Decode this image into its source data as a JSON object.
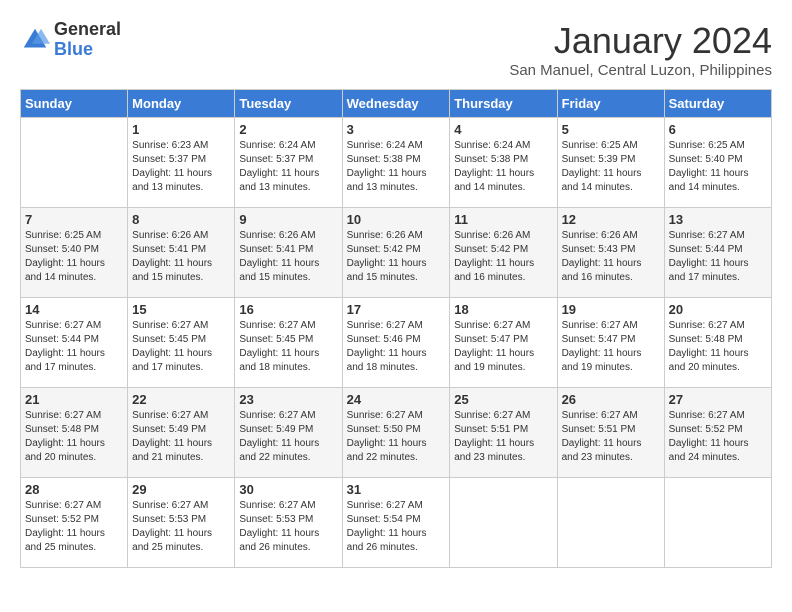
{
  "logo": {
    "general": "General",
    "blue": "Blue"
  },
  "title": "January 2024",
  "subtitle": "San Manuel, Central Luzon, Philippines",
  "columns": [
    "Sunday",
    "Monday",
    "Tuesday",
    "Wednesday",
    "Thursday",
    "Friday",
    "Saturday"
  ],
  "weeks": [
    [
      {
        "day": "",
        "sunrise": "",
        "sunset": "",
        "daylight": ""
      },
      {
        "day": "1",
        "sunrise": "Sunrise: 6:23 AM",
        "sunset": "Sunset: 5:37 PM",
        "daylight": "Daylight: 11 hours and 13 minutes."
      },
      {
        "day": "2",
        "sunrise": "Sunrise: 6:24 AM",
        "sunset": "Sunset: 5:37 PM",
        "daylight": "Daylight: 11 hours and 13 minutes."
      },
      {
        "day": "3",
        "sunrise": "Sunrise: 6:24 AM",
        "sunset": "Sunset: 5:38 PM",
        "daylight": "Daylight: 11 hours and 13 minutes."
      },
      {
        "day": "4",
        "sunrise": "Sunrise: 6:24 AM",
        "sunset": "Sunset: 5:38 PM",
        "daylight": "Daylight: 11 hours and 14 minutes."
      },
      {
        "day": "5",
        "sunrise": "Sunrise: 6:25 AM",
        "sunset": "Sunset: 5:39 PM",
        "daylight": "Daylight: 11 hours and 14 minutes."
      },
      {
        "day": "6",
        "sunrise": "Sunrise: 6:25 AM",
        "sunset": "Sunset: 5:40 PM",
        "daylight": "Daylight: 11 hours and 14 minutes."
      }
    ],
    [
      {
        "day": "7",
        "sunrise": "Sunrise: 6:25 AM",
        "sunset": "Sunset: 5:40 PM",
        "daylight": "Daylight: 11 hours and 14 minutes."
      },
      {
        "day": "8",
        "sunrise": "Sunrise: 6:26 AM",
        "sunset": "Sunset: 5:41 PM",
        "daylight": "Daylight: 11 hours and 15 minutes."
      },
      {
        "day": "9",
        "sunrise": "Sunrise: 6:26 AM",
        "sunset": "Sunset: 5:41 PM",
        "daylight": "Daylight: 11 hours and 15 minutes."
      },
      {
        "day": "10",
        "sunrise": "Sunrise: 6:26 AM",
        "sunset": "Sunset: 5:42 PM",
        "daylight": "Daylight: 11 hours and 15 minutes."
      },
      {
        "day": "11",
        "sunrise": "Sunrise: 6:26 AM",
        "sunset": "Sunset: 5:42 PM",
        "daylight": "Daylight: 11 hours and 16 minutes."
      },
      {
        "day": "12",
        "sunrise": "Sunrise: 6:26 AM",
        "sunset": "Sunset: 5:43 PM",
        "daylight": "Daylight: 11 hours and 16 minutes."
      },
      {
        "day": "13",
        "sunrise": "Sunrise: 6:27 AM",
        "sunset": "Sunset: 5:44 PM",
        "daylight": "Daylight: 11 hours and 17 minutes."
      }
    ],
    [
      {
        "day": "14",
        "sunrise": "Sunrise: 6:27 AM",
        "sunset": "Sunset: 5:44 PM",
        "daylight": "Daylight: 11 hours and 17 minutes."
      },
      {
        "day": "15",
        "sunrise": "Sunrise: 6:27 AM",
        "sunset": "Sunset: 5:45 PM",
        "daylight": "Daylight: 11 hours and 17 minutes."
      },
      {
        "day": "16",
        "sunrise": "Sunrise: 6:27 AM",
        "sunset": "Sunset: 5:45 PM",
        "daylight": "Daylight: 11 hours and 18 minutes."
      },
      {
        "day": "17",
        "sunrise": "Sunrise: 6:27 AM",
        "sunset": "Sunset: 5:46 PM",
        "daylight": "Daylight: 11 hours and 18 minutes."
      },
      {
        "day": "18",
        "sunrise": "Sunrise: 6:27 AM",
        "sunset": "Sunset: 5:47 PM",
        "daylight": "Daylight: 11 hours and 19 minutes."
      },
      {
        "day": "19",
        "sunrise": "Sunrise: 6:27 AM",
        "sunset": "Sunset: 5:47 PM",
        "daylight": "Daylight: 11 hours and 19 minutes."
      },
      {
        "day": "20",
        "sunrise": "Sunrise: 6:27 AM",
        "sunset": "Sunset: 5:48 PM",
        "daylight": "Daylight: 11 hours and 20 minutes."
      }
    ],
    [
      {
        "day": "21",
        "sunrise": "Sunrise: 6:27 AM",
        "sunset": "Sunset: 5:48 PM",
        "daylight": "Daylight: 11 hours and 20 minutes."
      },
      {
        "day": "22",
        "sunrise": "Sunrise: 6:27 AM",
        "sunset": "Sunset: 5:49 PM",
        "daylight": "Daylight: 11 hours and 21 minutes."
      },
      {
        "day": "23",
        "sunrise": "Sunrise: 6:27 AM",
        "sunset": "Sunset: 5:49 PM",
        "daylight": "Daylight: 11 hours and 22 minutes."
      },
      {
        "day": "24",
        "sunrise": "Sunrise: 6:27 AM",
        "sunset": "Sunset: 5:50 PM",
        "daylight": "Daylight: 11 hours and 22 minutes."
      },
      {
        "day": "25",
        "sunrise": "Sunrise: 6:27 AM",
        "sunset": "Sunset: 5:51 PM",
        "daylight": "Daylight: 11 hours and 23 minutes."
      },
      {
        "day": "26",
        "sunrise": "Sunrise: 6:27 AM",
        "sunset": "Sunset: 5:51 PM",
        "daylight": "Daylight: 11 hours and 23 minutes."
      },
      {
        "day": "27",
        "sunrise": "Sunrise: 6:27 AM",
        "sunset": "Sunset: 5:52 PM",
        "daylight": "Daylight: 11 hours and 24 minutes."
      }
    ],
    [
      {
        "day": "28",
        "sunrise": "Sunrise: 6:27 AM",
        "sunset": "Sunset: 5:52 PM",
        "daylight": "Daylight: 11 hours and 25 minutes."
      },
      {
        "day": "29",
        "sunrise": "Sunrise: 6:27 AM",
        "sunset": "Sunset: 5:53 PM",
        "daylight": "Daylight: 11 hours and 25 minutes."
      },
      {
        "day": "30",
        "sunrise": "Sunrise: 6:27 AM",
        "sunset": "Sunset: 5:53 PM",
        "daylight": "Daylight: 11 hours and 26 minutes."
      },
      {
        "day": "31",
        "sunrise": "Sunrise: 6:27 AM",
        "sunset": "Sunset: 5:54 PM",
        "daylight": "Daylight: 11 hours and 26 minutes."
      },
      {
        "day": "",
        "sunrise": "",
        "sunset": "",
        "daylight": ""
      },
      {
        "day": "",
        "sunrise": "",
        "sunset": "",
        "daylight": ""
      },
      {
        "day": "",
        "sunrise": "",
        "sunset": "",
        "daylight": ""
      }
    ]
  ]
}
